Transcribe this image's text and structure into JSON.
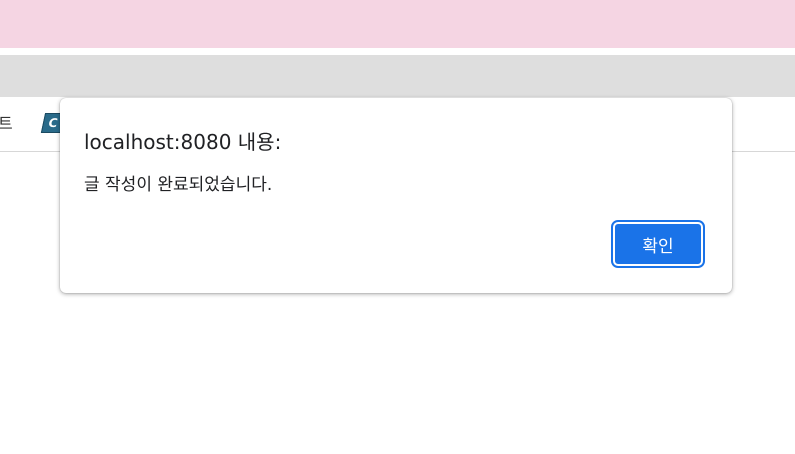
{
  "browser": {
    "bookmarks_partial_text": "트",
    "bookmark_icon_letter": "C"
  },
  "dialog": {
    "title": "localhost:8080 내용:",
    "message": "글 작성이 완료되었습니다.",
    "ok_label": "확인"
  },
  "colors": {
    "top_bar": "#f5d5e3",
    "toolbar": "#dedede",
    "button_accent": "#1a73e8"
  }
}
